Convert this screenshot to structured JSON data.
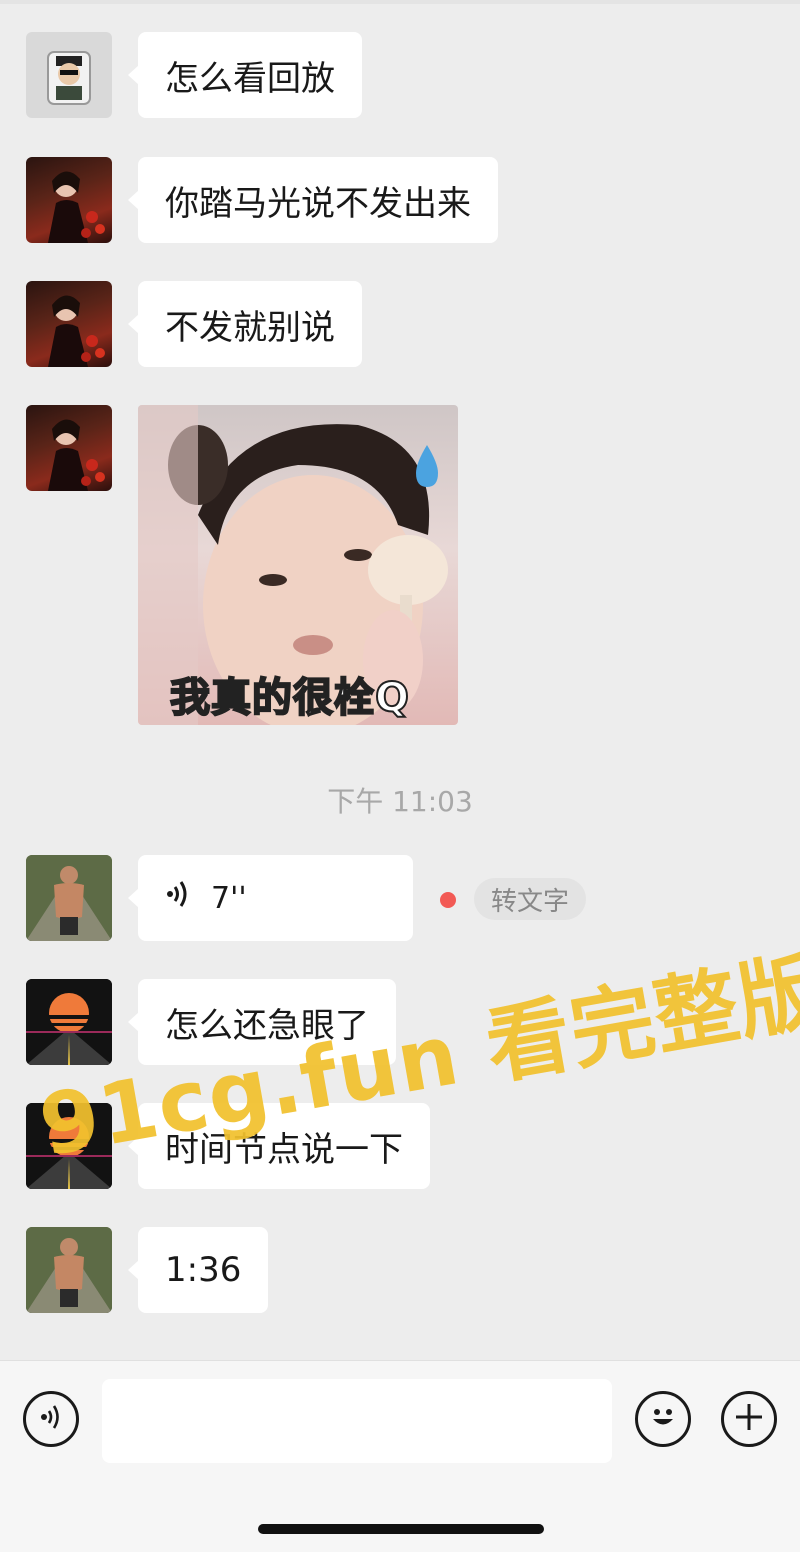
{
  "messages": [
    {
      "text": "怎么看回放"
    },
    {
      "text": "你踏马光说不发出来"
    },
    {
      "text": "不发就别说"
    },
    {
      "sticker_caption": "我真的很栓Q"
    },
    {
      "voice_length": "7''",
      "voice_to_text": "转文字"
    },
    {
      "text": "怎么还急眼了"
    },
    {
      "text": "时间节点说一下"
    },
    {
      "text": "1:36"
    }
  ],
  "timestamp": "下午 11:03",
  "watermark": "91cg.fun 看完整版",
  "colors": {
    "background": "#ededed",
    "bubble": "#ffffff",
    "unread_dot": "#f25a55",
    "watermark": "#f2c12e"
  },
  "icons": {
    "voice_toggle": "voice-icon",
    "emoji": "emoji-icon",
    "more": "plus-icon"
  }
}
